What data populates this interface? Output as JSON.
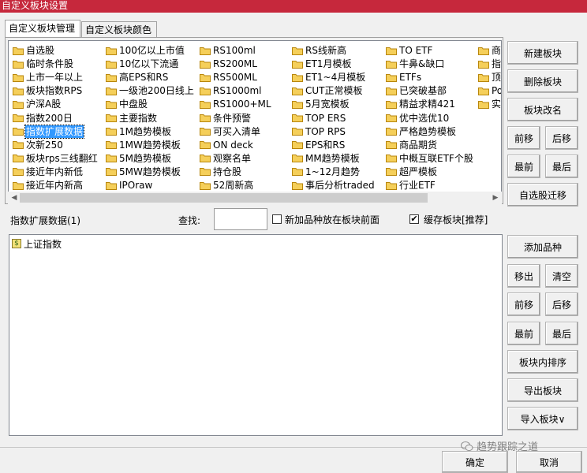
{
  "window": {
    "title": "自定义板块设置"
  },
  "tabs": [
    {
      "label": "自定义板块管理",
      "active": true
    },
    {
      "label": "自定义板块颜色",
      "active": false
    }
  ],
  "blocks": [
    [
      "自选股",
      "临时条件股",
      "上市一年以上",
      "板块指数RPS",
      "沪深A股",
      "指数200日",
      "指数扩展数据",
      "次新250",
      "板块rps三线翻红",
      "接近年内新低",
      "接近年内新高"
    ],
    [
      "100亿以上市值",
      "10亿以下流通",
      "高EPS和RS",
      "一级池200日线上",
      "中盘股",
      "主要指数",
      "1M趋势模板",
      "1MW趋势模板",
      "5M趋势模板",
      "5MW趋势模板",
      "IPOraw"
    ],
    [
      "RS100ml",
      "RS200ML",
      "RS500ML",
      "RS1000ml",
      "RS1000+ML",
      "条件预警",
      "可买入清单",
      "ON deck",
      "观察名单",
      "持仓股",
      "52周新高"
    ],
    [
      "RS线新高",
      "ET1月模板",
      "ET1~4月模板",
      "CUT正常模板",
      "5月宽模板",
      "TOP ERS",
      "TOP RPS",
      "EPS和RS",
      "MM趋势模板",
      "1~12月趋势",
      "事后分析traded"
    ],
    [
      "TO ETF",
      "牛鼻&缺口",
      "ETFs",
      "已突破基部",
      "精益求精421",
      "优中选优10",
      "严格趋势模板",
      "商品期货",
      "中概互联ETF个股",
      "超严模板",
      "行业ETF"
    ],
    [
      "商品",
      "指数",
      "顶部",
      "Pow",
      "实盘"
    ]
  ],
  "selected_block": "指数扩展数据",
  "side_buttons_top": [
    "新建板块",
    "删除板块",
    "板块改名",
    "前移",
    "后移",
    "最前",
    "最后",
    "自选股迁移"
  ],
  "current_block_label": "指数扩展数据(1)",
  "search": {
    "label": "查找:",
    "value": ""
  },
  "options": {
    "add_front": {
      "label": "新加品种放在板块前面",
      "checked": false
    },
    "cache": {
      "label": "缓存板块[推荐]",
      "checked": true
    }
  },
  "stocks": [
    {
      "name": "上证指数",
      "icon": "dollar-icon"
    }
  ],
  "side_buttons_bottom": [
    "添加品种",
    "移出",
    "清空",
    "前移",
    "后移",
    "最前",
    "最后",
    "板块内排序",
    "导出板块",
    "导入板块∨"
  ],
  "footer": {
    "ok": "确定",
    "cancel": "取消"
  },
  "watermark": "趋势跟踪之道",
  "colors": {
    "titlebar": "#c6283c",
    "selection": "#3399ff",
    "folder": "#f5cf5a"
  }
}
